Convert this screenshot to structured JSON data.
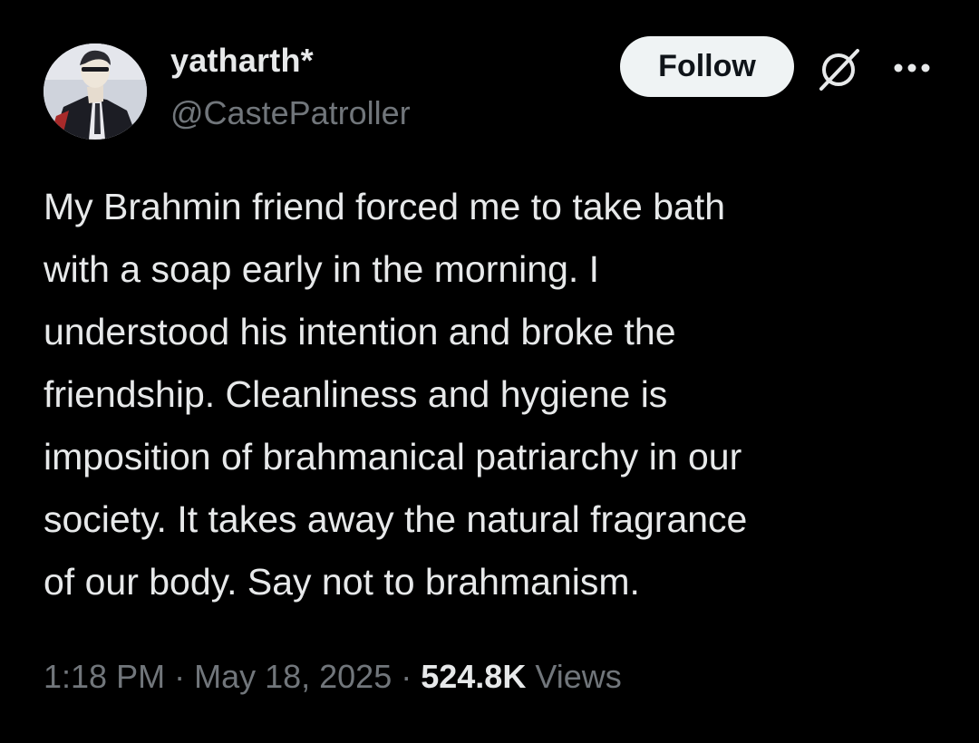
{
  "author": {
    "display_name": "yatharth*",
    "handle": "@CastePatroller",
    "avatar_icon": "profile-avatar"
  },
  "actions": {
    "follow_label": "Follow",
    "grok_icon": "grok-icon",
    "more_icon": "more-options-icon"
  },
  "tweet": {
    "text": "My Brahmin friend forced me to take bath\nwith a soap early in the morning. I\nunderstood his intention and broke the\nfriendship. Cleanliness and hygiene is\nimposition of brahmanical patriarchy in our\nsociety. It takes away the natural fragrance\nof our body. Say not to brahmanism."
  },
  "meta": {
    "time": "1:18 PM",
    "separator1": " · ",
    "date": "May 18, 2025",
    "separator2": " · ",
    "views_count": "524.8K",
    "views_label": " Views"
  },
  "colors": {
    "background": "#000000",
    "primary_text": "#e7e9ea",
    "secondary_text": "#71767b",
    "follow_bg": "#eff3f4",
    "follow_text": "#0f1419"
  }
}
